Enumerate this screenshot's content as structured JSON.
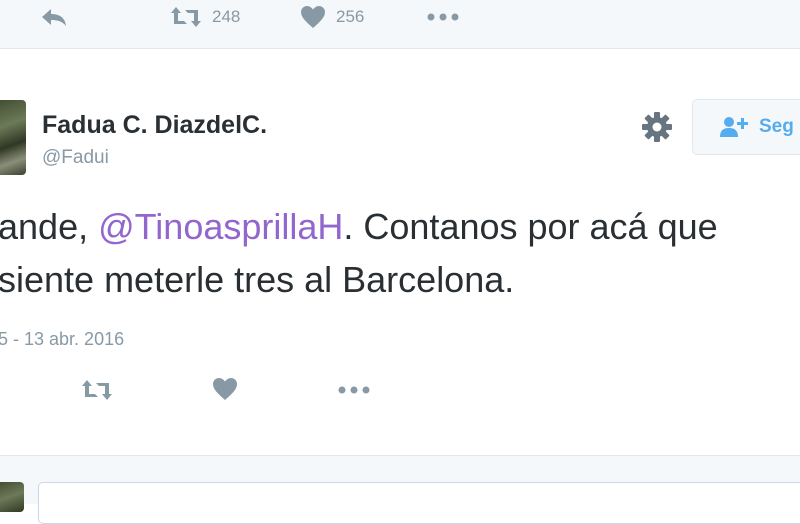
{
  "previous_tweet": {
    "retweet_count": "248",
    "like_count": "256"
  },
  "tweet": {
    "author_name": "Fadua C. DiazdelC.",
    "author_handle": "@Fadui",
    "follow_label": "Seg",
    "text_line1_part1": "ande, ",
    "text_mention": "@TinoasprillaH",
    "text_line1_part2": ". Contanos por acá que",
    "text_line2": "siente meterle tres al Barcelona.",
    "date_fragment": "5 - 13 abr. 2016"
  },
  "colors": {
    "mention": "#9266cc",
    "icon_gray": "#8899a6",
    "follow_blue": "#55acee"
  }
}
